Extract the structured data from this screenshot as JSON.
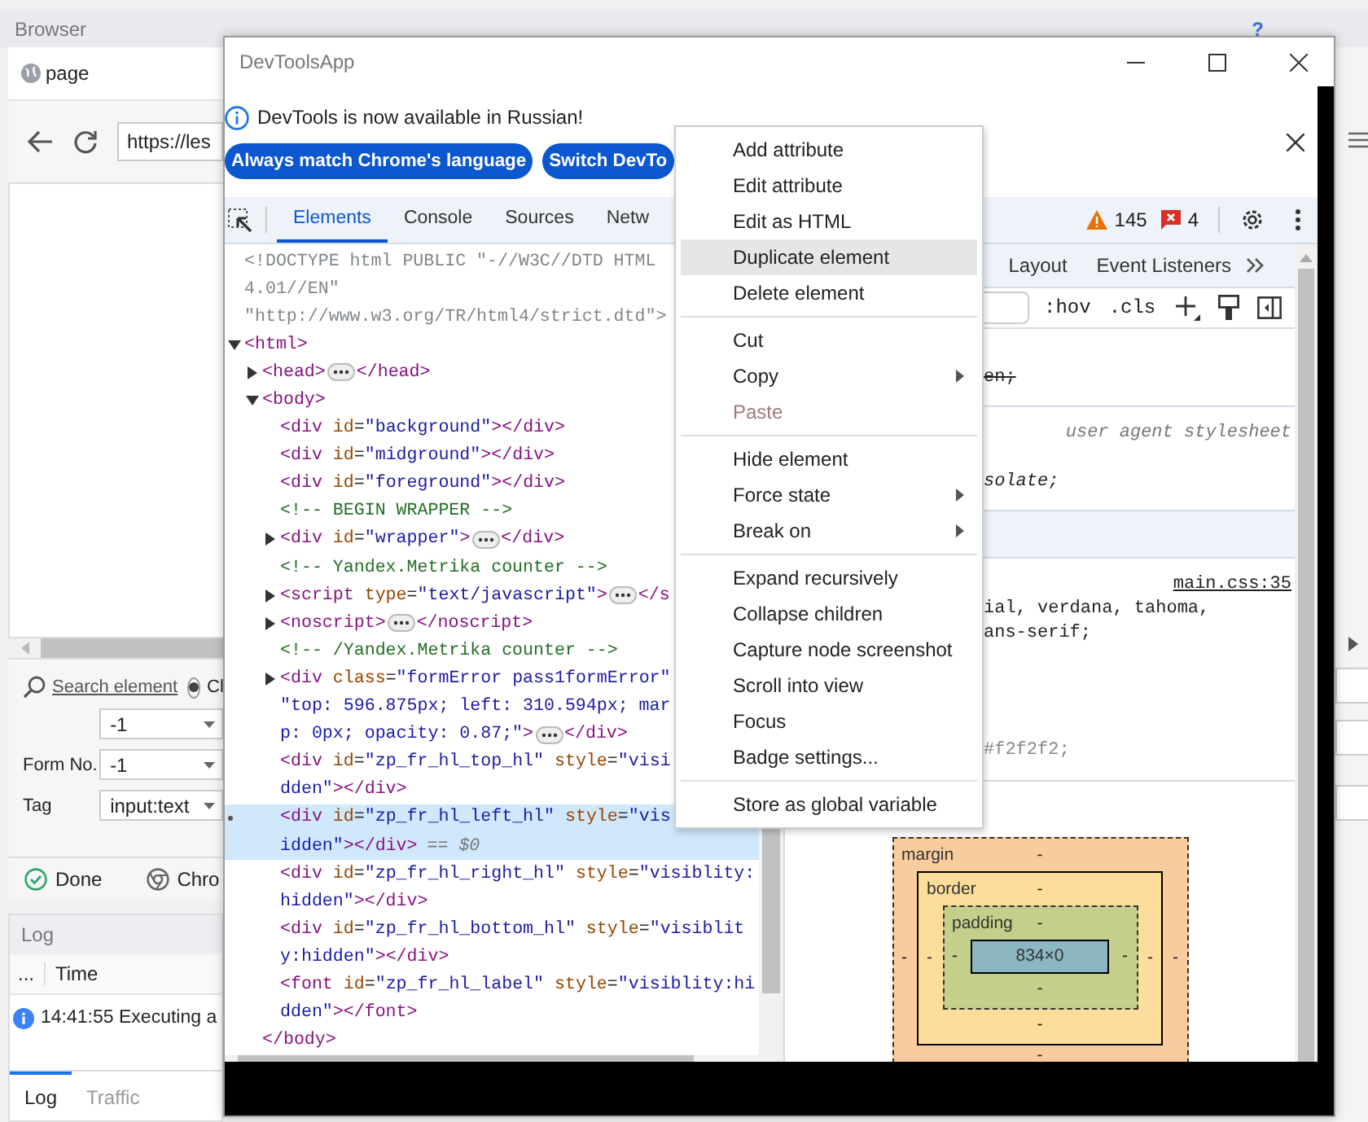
{
  "app": {
    "panel_title": "Browser",
    "help": "?",
    "tab": "page",
    "url": "https://les",
    "search_link": "Search element",
    "radio": {
      "label": "Cl",
      "selected": true
    },
    "fields": [
      {
        "value": "-1"
      },
      {
        "label": "Form No.",
        "value": "-1"
      },
      {
        "label": "Tag",
        "value": "input:text"
      }
    ],
    "status": {
      "done": "Done",
      "browser": "Chro"
    },
    "log": {
      "title": "Log",
      "columns": [
        "...",
        "Time"
      ],
      "rows": [
        {
          "time": "14:41:55",
          "message": "Executing a"
        }
      ],
      "tabs": [
        {
          "label": "Log",
          "selected": true
        },
        {
          "label": "Traffic",
          "selected": false
        }
      ]
    }
  },
  "devtools": {
    "title": "DevToolsApp",
    "infobar": {
      "message": "DevTools is now available in Russian!",
      "buttons": [
        "Always match Chrome's language",
        "Switch DevTo"
      ]
    },
    "tabs": [
      {
        "label": "Elements",
        "selected": true
      },
      {
        "label": "Console",
        "selected": false
      },
      {
        "label": "Sources",
        "selected": false
      },
      {
        "label": "Netw",
        "selected": false
      }
    ],
    "warnings": "145",
    "errors": "4",
    "dom_tree": [
      {
        "kind": "doctype",
        "selected": false,
        "lines": [
          "<!DOCTYPE html PUBLIC \"-//W3C//DTD HTML",
          "4.01//EN\"",
          "\"http://www.w3.org/TR/html4/strict.dtd\">"
        ]
      },
      {
        "kind": "element",
        "selected": false,
        "expanded": true,
        "lines": [
          "<html>"
        ],
        "children": [
          {
            "kind": "element",
            "selected": false,
            "expanded": false,
            "lines": [
              "<head>"
            ],
            "close": "</head>"
          },
          {
            "kind": "element",
            "selected": false,
            "expanded": true,
            "lines": [
              "<body>"
            ],
            "end": "</body>",
            "children": [
              {
                "kind": "element",
                "selected": false,
                "lines": [
                  "<div id=\"background\"></div>"
                ]
              },
              {
                "kind": "element",
                "selected": false,
                "lines": [
                  "<div id=\"midground\"></div>"
                ]
              },
              {
                "kind": "element",
                "selected": false,
                "lines": [
                  "<div id=\"foreground\"></div>"
                ]
              },
              {
                "kind": "comment",
                "selected": false,
                "lines": [
                  "<!-- BEGIN WRAPPER -->"
                ]
              },
              {
                "kind": "element",
                "selected": false,
                "expanded": false,
                "lines": [
                  "<div id=\"wrapper\">"
                ],
                "close": "</div>"
              },
              {
                "kind": "comment",
                "selected": false,
                "lines": [
                  "<!-- Yandex.Metrika counter -->"
                ]
              },
              {
                "kind": "element",
                "selected": false,
                "expanded": false,
                "lines": [
                  "<script type=\"text/javascript\">"
                ],
                "close": "</s"
              },
              {
                "kind": "element",
                "selected": false,
                "expanded": false,
                "lines": [
                  "<noscript>"
                ],
                "close": "</noscript>"
              },
              {
                "kind": "comment",
                "selected": false,
                "lines": [
                  "<!-- /Yandex.Metrika counter -->"
                ]
              },
              {
                "kind": "element",
                "selected": false,
                "expanded": false,
                "lines": [
                  "<div class=\"formError pass1formError\"",
                  "\"top: 596.875px; left: 310.594px; mar",
                  "p: 0px; opacity: 0.87;\">"
                ],
                "close": "</div>"
              },
              {
                "kind": "element",
                "selected": false,
                "lines": [
                  "<div id=\"zp_fr_hl_top_hl\" style=\"visi",
                  "dden\"></div>"
                ]
              },
              {
                "kind": "element",
                "selected": true,
                "lines": [
                  "<div id=\"zp_fr_hl_left_hl\" style=\"vis",
                  "idden\"></div>"
                ],
                "note": "== $0"
              },
              {
                "kind": "element",
                "selected": false,
                "lines": [
                  "<div id=\"zp_fr_hl_right_hl\" style=\"visiblity:",
                  "hidden\"></div>"
                ]
              },
              {
                "kind": "element",
                "selected": false,
                "lines": [
                  "<div id=\"zp_fr_hl_bottom_hl\" style=\"visiblit",
                  "y:hidden\"></div>"
                ]
              },
              {
                "kind": "element",
                "selected": false,
                "lines": [
                  "<font id=\"zp_fr_hl_label\" style=\"visiblity:hi",
                  "dden\"></font>"
                ]
              }
            ]
          }
        ]
      }
    ],
    "sidebar_tabs": [
      {
        "label": "Layout",
        "selected": false
      },
      {
        "label": "Event Listeners",
        "selected": false
      }
    ],
    "filter_buttons": [
      ":hov",
      ".cls"
    ],
    "style_rules": [
      {
        "kind": "plain",
        "lines": [
          {
            "kind": "blank"
          },
          {
            "kind": "text",
            "text": "en;",
            "struck": true
          }
        ]
      },
      {
        "kind": "agent",
        "source": "user agent stylesheet",
        "lines": [
          {
            "kind": "blank"
          },
          {
            "kind": "text",
            "text": "solate;",
            "struck": false
          }
        ]
      },
      {
        "kind": "header"
      },
      {
        "kind": "link",
        "source": "main.css:35",
        "lines": [
          {
            "kind": "text",
            "text": "ial, verdana, tahoma,",
            "struck": false
          },
          {
            "kind": "text",
            "text": "ans-serif;",
            "struck": false
          },
          {
            "kind": "blank"
          },
          {
            "kind": "blank"
          },
          {
            "kind": "blank"
          },
          {
            "kind": "blank"
          },
          {
            "kind": "text",
            "text": "#f2f2f2;",
            "struck": false,
            "inactive": true
          }
        ]
      }
    ],
    "box_model": {
      "margin": {
        "label": "margin",
        "top": "-",
        "right": "-",
        "bottom": "-",
        "left": "-"
      },
      "border": {
        "label": "border",
        "top": "-",
        "right": "-",
        "bottom": "-",
        "left": "-"
      },
      "padding": {
        "label": "padding",
        "top": "-",
        "right": "-",
        "bottom": "-",
        "left": "-"
      },
      "content": "834×0"
    },
    "context_menu": [
      [
        {
          "label": "Add attribute",
          "selected": false,
          "disabled": false,
          "submenu": false
        },
        {
          "label": "Edit attribute",
          "selected": false,
          "disabled": false,
          "submenu": false
        },
        {
          "label": "Edit as HTML",
          "selected": false,
          "disabled": false,
          "submenu": false
        },
        {
          "label": "Duplicate element",
          "selected": true,
          "disabled": false,
          "submenu": false
        },
        {
          "label": "Delete element",
          "selected": false,
          "disabled": false,
          "submenu": false
        }
      ],
      [
        {
          "label": "Cut",
          "selected": false,
          "disabled": false,
          "submenu": false
        },
        {
          "label": "Copy",
          "selected": false,
          "disabled": false,
          "submenu": true
        },
        {
          "label": "Paste",
          "selected": false,
          "disabled": true,
          "submenu": false
        }
      ],
      [
        {
          "label": "Hide element",
          "selected": false,
          "disabled": false,
          "submenu": false
        },
        {
          "label": "Force state",
          "selected": false,
          "disabled": false,
          "submenu": true
        },
        {
          "label": "Break on",
          "selected": false,
          "disabled": false,
          "submenu": true
        }
      ],
      [
        {
          "label": "Expand recursively",
          "selected": false,
          "disabled": false,
          "submenu": false
        },
        {
          "label": "Collapse children",
          "selected": false,
          "disabled": false,
          "submenu": false
        },
        {
          "label": "Capture node screenshot",
          "selected": false,
          "disabled": false,
          "submenu": false
        },
        {
          "label": "Scroll into view",
          "selected": false,
          "disabled": false,
          "submenu": false
        },
        {
          "label": "Focus",
          "selected": false,
          "disabled": false,
          "submenu": false
        },
        {
          "label": "Badge settings...",
          "selected": false,
          "disabled": false,
          "submenu": false
        }
      ],
      [
        {
          "label": "Store as global variable",
          "selected": false,
          "disabled": false,
          "submenu": false
        }
      ]
    ]
  }
}
